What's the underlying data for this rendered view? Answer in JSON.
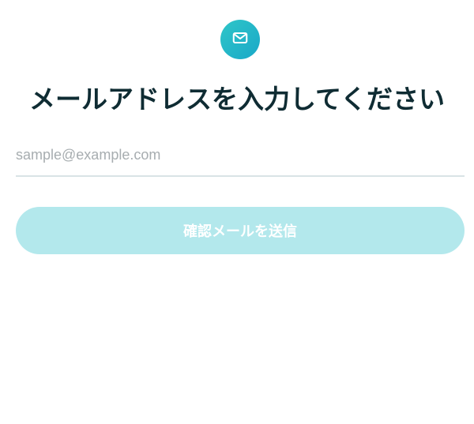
{
  "header": {
    "icon": "mail-icon",
    "title": "メールアドレスを入力してください"
  },
  "form": {
    "email": {
      "value": "",
      "placeholder": "sample@example.com"
    },
    "submit_label": "確認メールを送信"
  },
  "colors": {
    "icon_gradient_start": "#2fc6c8",
    "icon_gradient_end": "#1aa8c8",
    "title_text": "#0f2c33",
    "input_underline": "#d9e3e6",
    "button_background_disabled": "#b3e8ec",
    "button_text": "#ffffff"
  }
}
